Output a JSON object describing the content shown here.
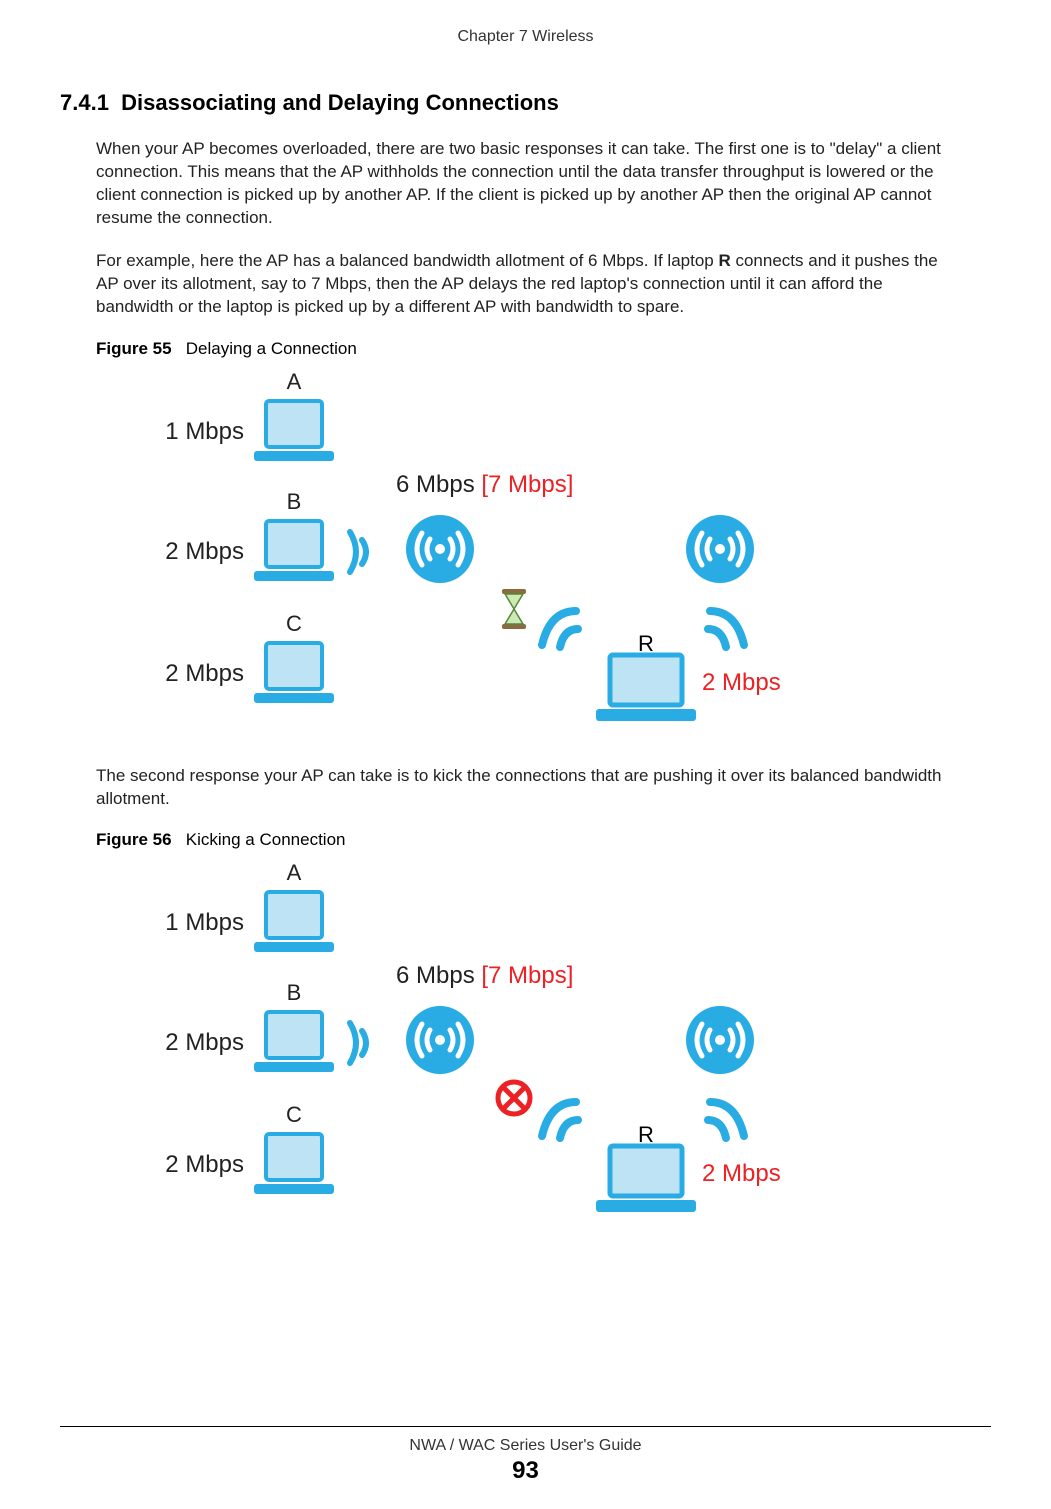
{
  "chapter_header": "Chapter 7 Wireless",
  "section": {
    "number": "7.4.1",
    "title": "Disassociating and Delaying Connections"
  },
  "para1": "When your AP becomes overloaded, there are two basic responses it can take. The first one is to \"delay\" a client connection. This means that the AP withholds the connection until the data transfer throughput is lowered or the client connection is picked up by another AP. If the client is picked up by another AP then the original AP cannot resume the connection.",
  "para2_pre": "For example, here the AP has a balanced bandwidth allotment of 6 Mbps. If laptop ",
  "para2_bold": "R",
  "para2_post": " connects and it pushes the AP over its allotment, say to 7 Mbps, then the AP delays the red laptop's connection until it can afford the bandwidth or the laptop is picked up by a different AP with bandwidth to spare.",
  "figure55": {
    "label": "Figure 55",
    "caption": "Delaying a Connection",
    "laptop_a": {
      "label": "A",
      "mbps": "1 Mbps"
    },
    "laptop_b": {
      "label": "B",
      "mbps": "2 Mbps"
    },
    "laptop_c": {
      "label": "C",
      "mbps": "2 Mbps"
    },
    "ap_main": "6 Mbps",
    "ap_over": "[7 Mbps]",
    "laptop_r": {
      "label": "R",
      "mbps": "2 Mbps"
    },
    "indicator": "hourglass"
  },
  "para3": "The second response your AP can take is to kick the connections that are pushing it over its balanced bandwidth allotment.",
  "figure56": {
    "label": "Figure 56",
    "caption": "Kicking a Connection",
    "laptop_a": {
      "label": "A",
      "mbps": "1 Mbps"
    },
    "laptop_b": {
      "label": "B",
      "mbps": "2 Mbps"
    },
    "laptop_c": {
      "label": "C",
      "mbps": "2 Mbps"
    },
    "ap_main": "6 Mbps",
    "ap_over": "[7 Mbps]",
    "laptop_r": {
      "label": "R",
      "mbps": "2 Mbps"
    },
    "indicator": "block"
  },
  "footer": {
    "guide": "NWA / WAC Series User's Guide",
    "page": "93"
  }
}
